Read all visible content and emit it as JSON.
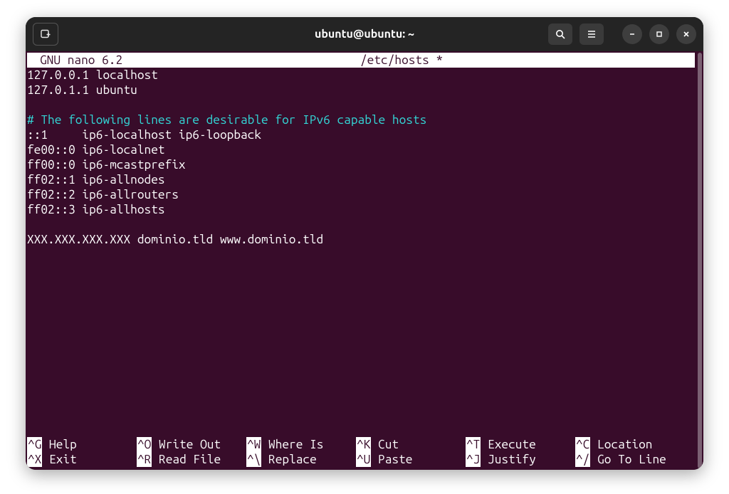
{
  "titlebar": {
    "title": "ubuntu@ubuntu: ~"
  },
  "nano": {
    "app_version": "GNU nano 6.2",
    "file_title": "/etc/hosts *"
  },
  "file_lines": [
    {
      "t": "plain",
      "text": "127.0.0.1 localhost"
    },
    {
      "t": "plain",
      "text": "127.0.1.1 ubuntu"
    },
    {
      "t": "plain",
      "text": ""
    },
    {
      "t": "comment",
      "text": "# The following lines are desirable for IPv6 capable hosts"
    },
    {
      "t": "plain",
      "text": "::1     ip6-localhost ip6-loopback"
    },
    {
      "t": "plain",
      "text": "fe00::0 ip6-localnet"
    },
    {
      "t": "plain",
      "text": "ff00::0 ip6-mcastprefix"
    },
    {
      "t": "plain",
      "text": "ff02::1 ip6-allnodes"
    },
    {
      "t": "plain",
      "text": "ff02::2 ip6-allrouters"
    },
    {
      "t": "plain",
      "text": "ff02::3 ip6-allhosts"
    },
    {
      "t": "plain",
      "text": ""
    },
    {
      "t": "plain",
      "text": "XXX.XXX.XXX.XXX dominio.tld www.dominio.tld"
    }
  ],
  "shortcuts": {
    "row1": [
      {
        "key": "^G",
        "label": "Help"
      },
      {
        "key": "^O",
        "label": "Write Out"
      },
      {
        "key": "^W",
        "label": "Where Is"
      },
      {
        "key": "^K",
        "label": "Cut"
      },
      {
        "key": "^T",
        "label": "Execute"
      },
      {
        "key": "^C",
        "label": "Location"
      }
    ],
    "row2": [
      {
        "key": "^X",
        "label": "Exit"
      },
      {
        "key": "^R",
        "label": "Read File"
      },
      {
        "key": "^\\",
        "label": "Replace"
      },
      {
        "key": "^U",
        "label": "Paste"
      },
      {
        "key": "^J",
        "label": "Justify"
      },
      {
        "key": "^/",
        "label": "Go To Line"
      }
    ]
  }
}
